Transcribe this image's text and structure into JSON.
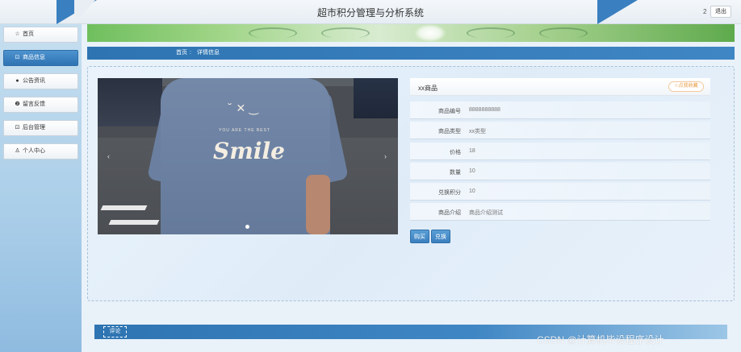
{
  "header": {
    "title": "超市积分管理与分析系统",
    "user_count": "2",
    "logout_label": "退出"
  },
  "sidebar": {
    "items": [
      {
        "icon": "☆",
        "icon_name": "star-icon",
        "label": "首页",
        "active": false
      },
      {
        "icon": "⊡",
        "icon_name": "goods-icon",
        "label": "商品信息",
        "active": true
      },
      {
        "icon": "●",
        "icon_name": "notice-icon",
        "label": "公告资讯",
        "active": false
      },
      {
        "icon": "❷",
        "icon_name": "feedback-icon",
        "label": "留言反馈",
        "active": false
      },
      {
        "icon": "⊡",
        "icon_name": "admin-icon",
        "label": "后台管理",
        "active": false
      },
      {
        "icon": "♙",
        "icon_name": "user-icon",
        "label": "个人中心",
        "active": false
      }
    ]
  },
  "breadcrumb": {
    "home": "首页",
    "separator": ":",
    "current": "详情信息"
  },
  "photo": {
    "face_text": "˘ ✕ ‿",
    "tagline": "YOU ARE THE BEST",
    "shirt_text": "Smile",
    "prev": "‹",
    "next": "›"
  },
  "product": {
    "name": "xx商品",
    "favorite_label": "☆点我收藏",
    "fields": [
      {
        "key": "商品编号",
        "value": "8888888888"
      },
      {
        "key": "商品类型",
        "value": "xx类型"
      },
      {
        "key": "价格",
        "value": "18"
      },
      {
        "key": "数量",
        "value": "10"
      },
      {
        "key": "兑换积分",
        "value": "10"
      },
      {
        "key": "商品介绍",
        "value": "商品介绍测试"
      }
    ]
  },
  "actions": {
    "buy_label": "购买",
    "exchange_label": "兑换"
  },
  "comments": {
    "tab_label": "评论"
  },
  "watermark": "CSDN @计算机毕设程序设计",
  "colors": {
    "primary": "#3a7fbf",
    "accent_orange": "#e7993f"
  }
}
